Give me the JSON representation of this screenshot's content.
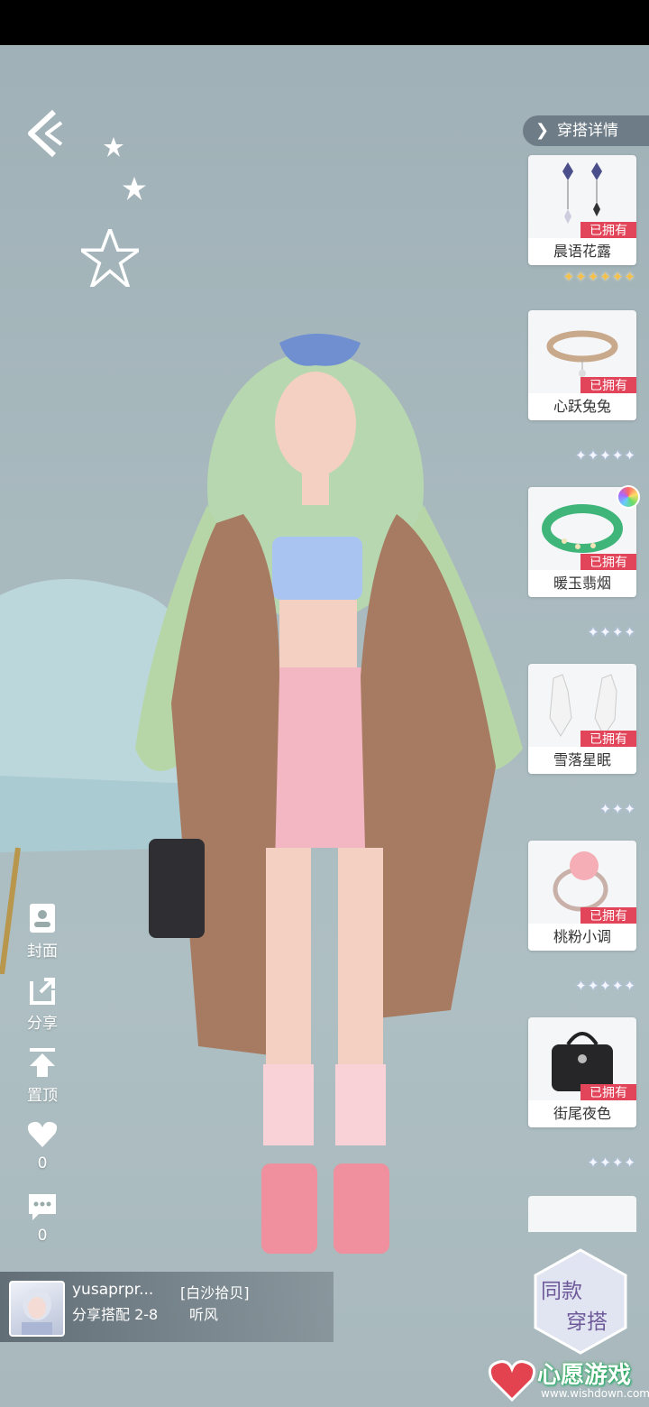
{
  "header": {
    "detail_label": "穿搭详情"
  },
  "side_tools": [
    {
      "label": "封面",
      "icon": "cover-icon"
    },
    {
      "label": "分享",
      "icon": "share-icon"
    },
    {
      "label": "置顶",
      "icon": "pin-top-icon"
    },
    {
      "label": "0",
      "icon": "heart-icon"
    },
    {
      "label": "0",
      "icon": "comment-icon"
    }
  ],
  "items": [
    {
      "name": "晨语花露",
      "status": "已拥有",
      "stars": 6,
      "rarity": "gold",
      "art": "earrings"
    },
    {
      "name": "心跃兔兔",
      "status": "已拥有",
      "stars": 5,
      "rarity": "silver",
      "art": "choker"
    },
    {
      "name": "暖玉翡烟",
      "status": "已拥有",
      "stars": 4,
      "rarity": "silver",
      "art": "bracelet"
    },
    {
      "name": "雪落星眠",
      "status": "已拥有",
      "stars": 3,
      "rarity": "silver",
      "art": "gloves"
    },
    {
      "name": "桃粉小调",
      "status": "已拥有",
      "stars": 5,
      "rarity": "silver",
      "art": "ring"
    },
    {
      "name": "街尾夜色",
      "status": "已拥有",
      "stars": 4,
      "rarity": "silver",
      "art": "handbag"
    }
  ],
  "author": {
    "username": "yusaprpr...",
    "tag": "[白沙拾贝]",
    "subtitle": "分享搭配 2-8",
    "subtitle2": "听风"
  },
  "same_outfit": {
    "line1": "同款",
    "line2": "穿搭"
  },
  "watermark": {
    "text": "心愿游戏",
    "url": "www.wishdown.com"
  },
  "colors": {
    "owned_badge": "#e2455a",
    "background": "#a9babf",
    "gold_star": "#f5c04a"
  }
}
